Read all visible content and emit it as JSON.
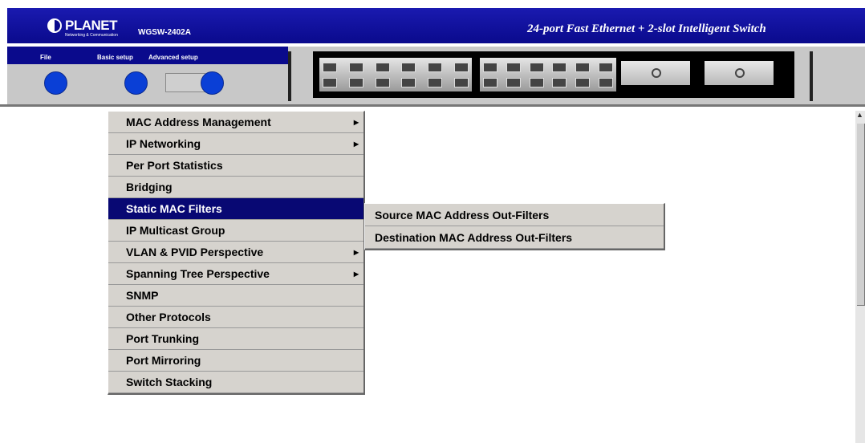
{
  "header": {
    "logo": "PLANET",
    "logo_sub": "Networking & Communication",
    "model": "WGSW-2402A",
    "tagline": "24-port Fast Ethernet + 2-slot Intelligent Switch"
  },
  "toolbar": {
    "file_label": "File",
    "basic_label": "Basic setup",
    "advanced_label": "Advanced setup"
  },
  "menu": {
    "items": [
      {
        "label": "MAC Address Management",
        "has_submenu": true
      },
      {
        "label": "IP Networking",
        "has_submenu": true
      },
      {
        "label": "Per Port Statistics",
        "has_submenu": false
      },
      {
        "label": "Bridging",
        "has_submenu": false
      },
      {
        "label": "Static MAC Filters",
        "has_submenu": false,
        "selected": true
      },
      {
        "label": "IP Multicast Group",
        "has_submenu": false
      },
      {
        "label": "VLAN & PVID Perspective",
        "has_submenu": true
      },
      {
        "label": "Spanning Tree Perspective",
        "has_submenu": true
      },
      {
        "label": "SNMP",
        "has_submenu": false
      },
      {
        "label": "Other Protocols",
        "has_submenu": false
      },
      {
        "label": "Port Trunking",
        "has_submenu": false
      },
      {
        "label": "Port Mirroring",
        "has_submenu": false
      },
      {
        "label": "Switch Stacking",
        "has_submenu": false
      }
    ]
  },
  "submenu": {
    "items": [
      {
        "label": "Source MAC Address Out-Filters"
      },
      {
        "label": "Destination MAC Address Out-Filters"
      }
    ]
  },
  "icons": {
    "submenu_arrow": "triangle-right-icon",
    "scroll_up": "triangle-up-icon"
  },
  "colors": {
    "header_blue": "#0a0a8c",
    "selected_bg": "#080873",
    "menu_bg": "#d6d3ce"
  }
}
